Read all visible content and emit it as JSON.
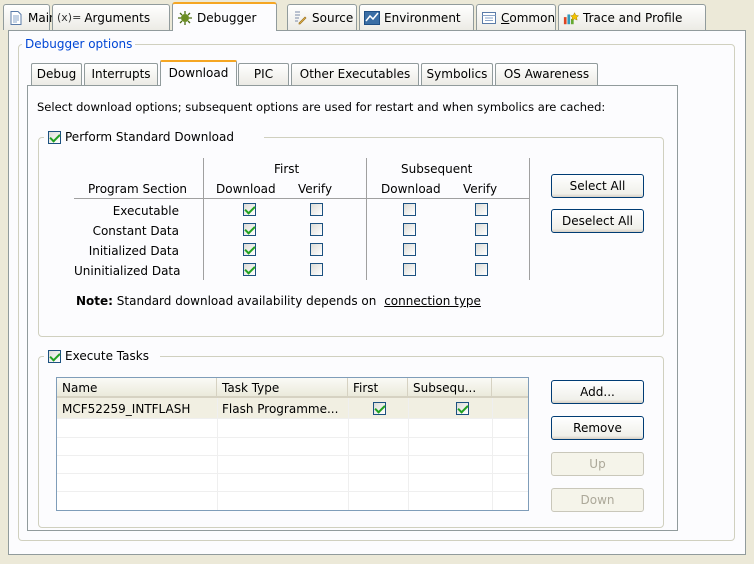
{
  "top_tabs": [
    {
      "label": "Main",
      "icon": "document-icon"
    },
    {
      "label": "Arguments",
      "icon": "arguments-icon",
      "prefix": "(x)="
    },
    {
      "label": "Debugger",
      "icon": "debugger-bug-icon"
    },
    {
      "label": "Source",
      "icon": "source-icon"
    },
    {
      "label": "Environment",
      "icon": "environment-icon"
    },
    {
      "label": "Common",
      "icon": "common-icon"
    },
    {
      "label": "Trace and Profile",
      "icon": "trace-profile-icon"
    }
  ],
  "active_top_tab": "Debugger",
  "debugger_options": {
    "group_title": "Debugger options",
    "tabs": [
      "Debug",
      "Interrupts",
      "Download",
      "PIC",
      "Other Executables",
      "Symbolics",
      "OS Awareness"
    ],
    "active_tab": "Download"
  },
  "download": {
    "description": "Select download options; subsequent options are used for restart and when symbolics are cached:",
    "standard_download": {
      "label": "Perform Standard Download",
      "checked": true,
      "header_first": "First",
      "header_subsequent": "Subsequent",
      "col_program_section": "Program Section",
      "col_download": "Download",
      "col_verify": "Verify",
      "rows": [
        {
          "section": "Executable",
          "first_download": true,
          "first_verify": false,
          "sub_download": false,
          "sub_verify": false
        },
        {
          "section": "Constant Data",
          "first_download": true,
          "first_verify": false,
          "sub_download": false,
          "sub_verify": false
        },
        {
          "section": "Initialized Data",
          "first_download": true,
          "first_verify": false,
          "sub_download": false,
          "sub_verify": false
        },
        {
          "section": "Uninitialized Data",
          "first_download": true,
          "first_verify": false,
          "sub_download": false,
          "sub_verify": false
        }
      ],
      "select_all": "Select All",
      "deselect_all": "Deselect All",
      "note_bold": "Note:",
      "note_text": "Standard download availability depends on",
      "note_link": "connection type"
    },
    "execute_tasks": {
      "label": "Execute Tasks",
      "checked": true,
      "columns": [
        "Name",
        "Task Type",
        "First",
        "Subsequ..."
      ],
      "rows": [
        {
          "name": "MCF52259_INTFLASH",
          "task_type": "Flash Programme...",
          "first": true,
          "subsequent": true
        }
      ],
      "buttons": {
        "add": "Add...",
        "remove": "Remove",
        "up": "Up",
        "down": "Down"
      }
    }
  },
  "colors": {
    "accent_tab": "#f5a623",
    "group_title": "#0046d5",
    "check": "#21a121"
  }
}
